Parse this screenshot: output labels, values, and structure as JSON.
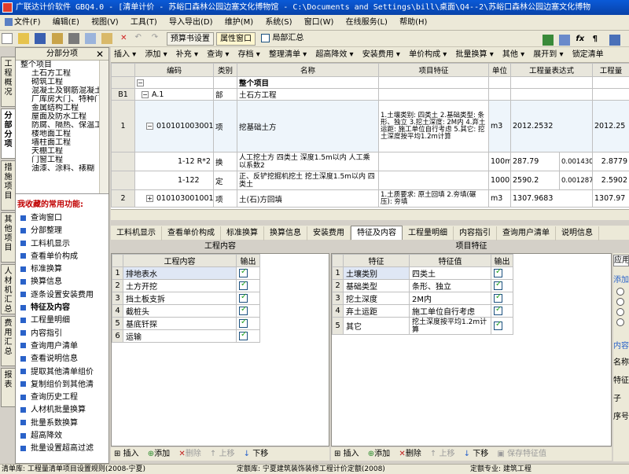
{
  "title": "广联达计价软件 GBQ4.0 - [清单计价 - 苏峪口森林公园边塞文化博物馆 - C:\\Documents and Settings\\bill\\桌面\\Q4--2\\苏峪口森林公园边塞文化博物",
  "menu": [
    "文件(F)",
    "编辑(E)",
    "视图(V)",
    "工具(T)",
    "导入导出(D)",
    "维护(M)",
    "系统(S)",
    "窗口(W)",
    "在线服务(L)",
    "帮助(H)"
  ],
  "toolbar1": {
    "budget_check": "预算书设置",
    "attr_window": "属性窗口",
    "local_summary": "局部汇总"
  },
  "vtabs": [
    "工程概况",
    "分部分项",
    "措施项目",
    "其他项目",
    "人材机汇总",
    "费用汇总",
    "报表"
  ],
  "left": {
    "header": "分部分项",
    "close": "✕",
    "tree": [
      "整个项目",
      "土石方工程",
      "砌筑工程",
      "混凝土及钢筋混凝土",
      "厂库房大门、特种门",
      "金属结构工程",
      "屋面及防水工程",
      "防腐、隔热、保温工",
      "楼地面工程",
      "墙柱面工程",
      "天棚工程",
      "门窗工程",
      "油漆、涂料、裱糊"
    ],
    "fav_title": "我收藏的常用功能:",
    "fav": [
      "查询窗口",
      "分部整理",
      "工料机显示",
      "查看单价构成",
      "标准换算",
      "换算信息",
      "逐条设置安装费用",
      "特征及内容",
      "工程量明细",
      "内容指引",
      "查询用户清单",
      "查看说明信息",
      "提取其他清单组价",
      "复制组价到其他清",
      "查询历史工程",
      "人材机批量换算",
      "批量系数换算",
      "超高降效",
      "批量设置超高过滤"
    ]
  },
  "toolbar2": [
    "插入 ▾",
    "添加 ▾",
    "补充 ▾",
    "查询 ▾",
    "存档 ▾",
    "整理清单 ▾",
    "超高降效 ▾",
    "安装费用 ▾",
    "单价构成 ▾",
    "批量换算 ▾",
    "其他 ▾",
    "展开到 ▾",
    "锁定清单"
  ],
  "grid": {
    "headers": [
      "编码",
      "类别",
      "名称",
      "项目特征",
      "单位",
      "工程量表达式",
      "工程量"
    ],
    "rows": [
      {
        "rh": "",
        "code": "",
        "cat": "",
        "name": "整个项目",
        "feat": "",
        "unit": "",
        "expr": "",
        "qty": ""
      },
      {
        "rh": "B1",
        "code": "A.1",
        "cat": "部",
        "name": "土石方工程",
        "feat": "",
        "unit": "",
        "expr": "",
        "qty": ""
      },
      {
        "rh": "1",
        "code": "010101003001",
        "cat": "项",
        "name": "挖基础土方",
        "feat": "1.土壤类别: 四类土 2.基础类型: 条形、独立 3.挖土深度: 2M内 4.弃土运距: 施工单位自行考虑 5.其它: 挖土深度按平均1.2m计算",
        "unit": "m3",
        "expr": "2012.2532",
        "qty": "2012.25"
      },
      {
        "rh": "",
        "code": "1-12 R*2",
        "cat": "换",
        "name": "人工挖土方 四类土 深度1.5m以内 人工乘以系数2",
        "feat": "",
        "unit": "100m3",
        "expr": "287.79",
        "expr2": "0.0014302",
        "qty": "2.8779"
      },
      {
        "rh": "",
        "code": "1-122",
        "cat": "定",
        "name": "正、反铲挖掘机挖土 挖土深度1.5m以内 四类土",
        "feat": "",
        "unit": "1000m3",
        "expr": "2590.2",
        "expr2": "0.0012872",
        "qty": "2.5902"
      },
      {
        "rh": "2",
        "code": "010103001001",
        "cat": "项",
        "name": "土(石)方回填",
        "feat": "1.土质要求: 原土回填 2.夯填(碾压): 夯填",
        "unit": "m3",
        "expr": "1307.9683",
        "qty": "1307.97"
      }
    ]
  },
  "btabs": [
    "工料机显示",
    "查看单价构成",
    "标准换算",
    "换算信息",
    "安装费用",
    "特征及内容",
    "工程量明细",
    "内容指引",
    "查询用户清单",
    "说明信息"
  ],
  "work": {
    "title": "工程内容",
    "headers": [
      "工程内容",
      "输出"
    ],
    "rows": [
      "排地表水",
      "土方开挖",
      "挡土板支拆",
      "截桩头",
      "基底钎探",
      "运输"
    ]
  },
  "feature": {
    "title": "项目特征",
    "headers": [
      "特征",
      "特征值",
      "输出"
    ],
    "rows": [
      [
        "土壤类别",
        "四类土"
      ],
      [
        "基础类型",
        "条形、独立"
      ],
      [
        "挖土深度",
        "2M内"
      ],
      [
        "弃土运距",
        "施工单位自行考虑"
      ],
      [
        "其它",
        "挖土深度按平均1.2m计算"
      ]
    ]
  },
  "ptool_left": [
    "插入",
    "添加",
    "删除",
    "上移",
    "下移"
  ],
  "ptool_right": [
    "插入",
    "添加",
    "删除",
    "上移",
    "下移",
    "保存特征值"
  ],
  "right_side": {
    "apply": "应用",
    "add": "添加",
    "content": "内容",
    "name": "名称",
    "feat": "特征",
    "sub": "子",
    "seq": "序号"
  },
  "status": {
    "list": "清单库: 工程量清单项目设置规则(2008-宁夏)",
    "quota": "定额库: 宁夏建筑装饰装修工程计价定额(2008)",
    "major": "定额专业: 建筑工程"
  }
}
